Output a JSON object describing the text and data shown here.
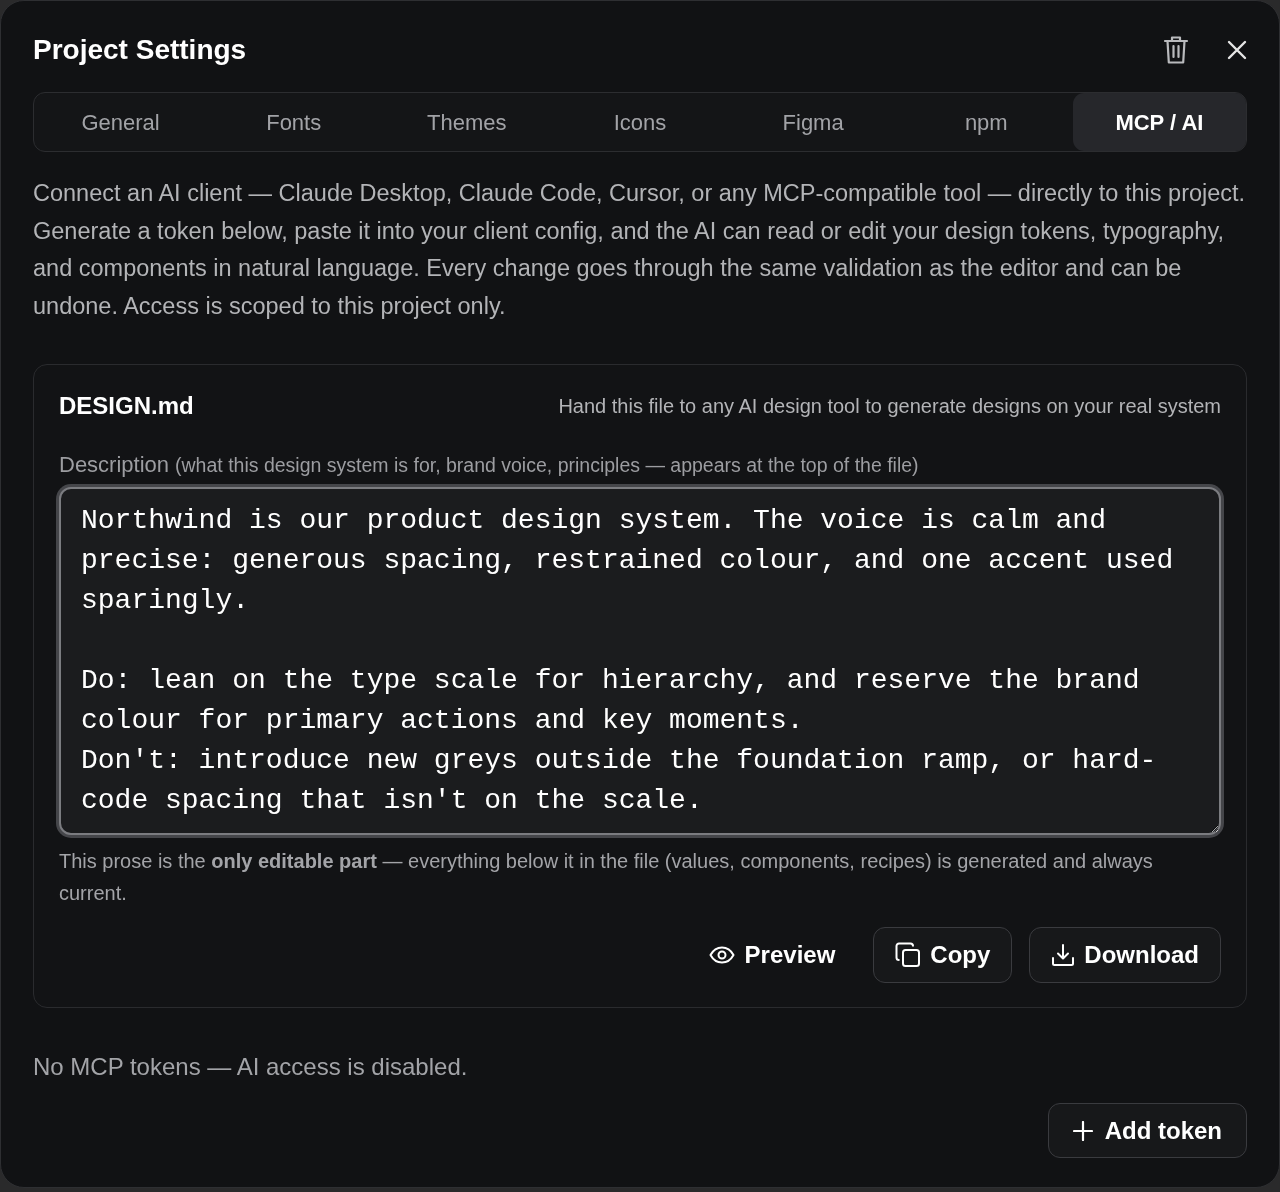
{
  "window": {
    "title": "Project Settings"
  },
  "tabs": [
    {
      "label": "General",
      "selected": false
    },
    {
      "label": "Fonts",
      "selected": false
    },
    {
      "label": "Themes",
      "selected": false
    },
    {
      "label": "Icons",
      "selected": false
    },
    {
      "label": "Figma",
      "selected": false
    },
    {
      "label": "npm",
      "selected": false
    },
    {
      "label": "MCP / AI",
      "selected": true
    }
  ],
  "intro": "Connect an AI client — Claude Desktop, Claude Code, Cursor, or any MCP-compatible tool — directly to this project. Generate a token below, paste it into your client config, and the AI can read or edit your design tokens, typography, and components in natural language. Every change goes through the same validation as the editor and can be undone. Access is scoped to this project only.",
  "design_file": {
    "title": "DESIGN.md",
    "hint": "Hand this file to any AI design tool to generate designs on your real system",
    "field": {
      "label": "Description",
      "label_note": "(what this design system is for, brand voice, principles — appears at the top of the file)",
      "value": "Northwind is our product design system. The voice is calm and precise: generous spacing, restrained colour, and one accent used sparingly.\n\nDo: lean on the type scale for hierarchy, and reserve the brand colour for primary actions and key moments.\nDon't: introduce new greys outside the foundation ramp, or hard-code spacing that isn't on the scale."
    },
    "note": "This prose is the **only editable part** — everything below it in the file (values, components, recipes) is generated and always current.",
    "actions": [
      {
        "label": "Preview",
        "kind": "preview"
      },
      {
        "label": "Copy",
        "kind": "copy"
      },
      {
        "label": "Download",
        "kind": "download"
      }
    ]
  },
  "tokens": {
    "empty_message": "No MCP tokens — AI access is disabled.",
    "add_button": "Add token"
  }
}
